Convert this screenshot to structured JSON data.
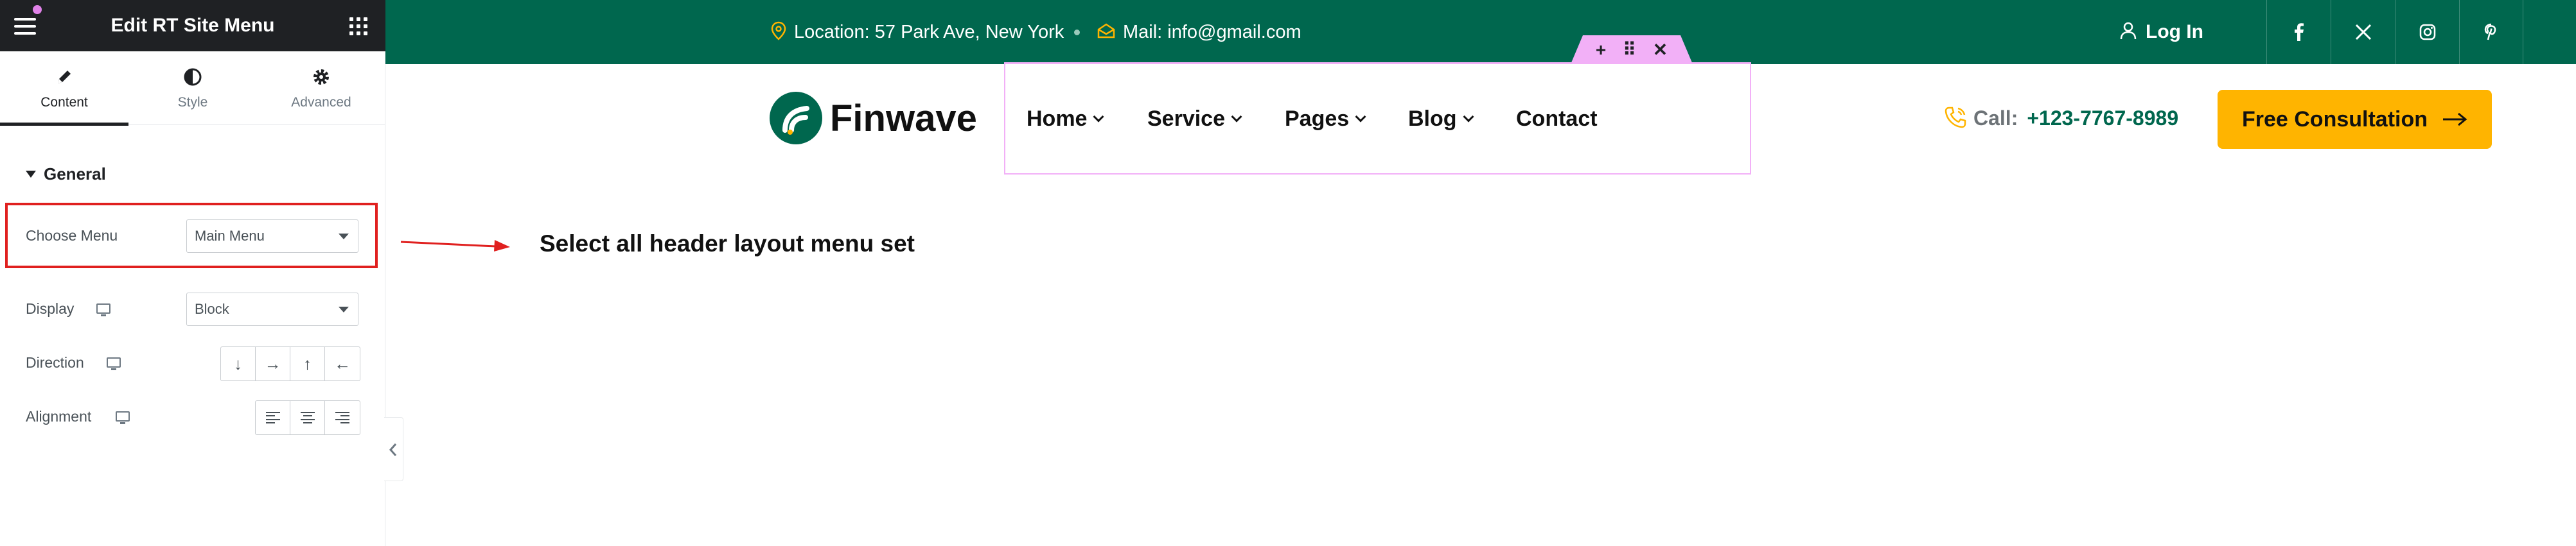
{
  "editor": {
    "title": "Edit RT Site Menu",
    "tabs": [
      {
        "label": "Content",
        "icon": "pencil-icon",
        "active": true
      },
      {
        "label": "Style",
        "icon": "half-circle-icon",
        "active": false
      },
      {
        "label": "Advanced",
        "icon": "gear-icon",
        "active": false
      }
    ],
    "section": "General",
    "choose_menu": {
      "label": "Choose Menu",
      "value": "Main Menu"
    },
    "display": {
      "label": "Display",
      "value": "Block"
    },
    "direction": {
      "label": "Direction",
      "options": [
        "↓",
        "→",
        "↑",
        "←"
      ]
    },
    "alignment": {
      "label": "Alignment",
      "options": [
        "align-left-icon",
        "align-center-icon",
        "align-right-icon"
      ]
    }
  },
  "topbar": {
    "location": "Location: 57 Park Ave, New York",
    "mail": "Mail: info@gmail.com",
    "login": "Log In",
    "socials": [
      "facebook-icon",
      "x-icon",
      "instagram-icon",
      "pinterest-icon"
    ]
  },
  "header": {
    "logo": "Finwave",
    "nav": [
      {
        "label": "Home",
        "has_dropdown": true
      },
      {
        "label": "Service",
        "has_dropdown": true
      },
      {
        "label": "Pages",
        "has_dropdown": true
      },
      {
        "label": "Blog",
        "has_dropdown": true
      },
      {
        "label": "Contact",
        "has_dropdown": false
      }
    ],
    "call_label": "Call:",
    "call_number": "+123-7767-8989",
    "cta": "Free Consultation"
  },
  "annotation": "Select all header layout menu set",
  "colors": {
    "brand_green": "#00674e",
    "cta_yellow": "#ffb400",
    "highlight_red": "#e0201f",
    "widget_pink": "#f2b0f7",
    "panel_dark": "#1f2124"
  }
}
